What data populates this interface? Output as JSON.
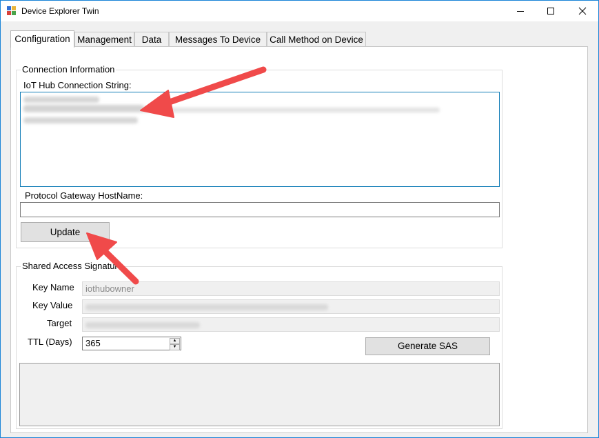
{
  "window": {
    "title": "Device Explorer Twin",
    "controls": {
      "minimize": "—",
      "maximize": "☐",
      "close": "✕"
    }
  },
  "tabs": [
    {
      "label": "Configuration",
      "active": true
    },
    {
      "label": "Management"
    },
    {
      "label": "Data"
    },
    {
      "label": "Messages To Device"
    },
    {
      "label": "Call Method on Device"
    }
  ],
  "connection": {
    "group_label": "Connection Information",
    "connection_string_label": "IoT Hub Connection String:",
    "protocol_gateway_label": "Protocol Gateway HostName:",
    "protocol_gateway_value": "",
    "update_button": "Update"
  },
  "sas": {
    "group_label": "Shared Access Signature",
    "key_name_label": "Key Name",
    "key_name_value": "iothubowner",
    "key_value_label": "Key Value",
    "target_label": "Target",
    "ttl_label": "TTL (Days)",
    "ttl_value": "365",
    "generate_button": "Generate SAS"
  },
  "colors": {
    "accent_border": "#0f7bb6",
    "annotation_arrow": "#f04a4a"
  }
}
